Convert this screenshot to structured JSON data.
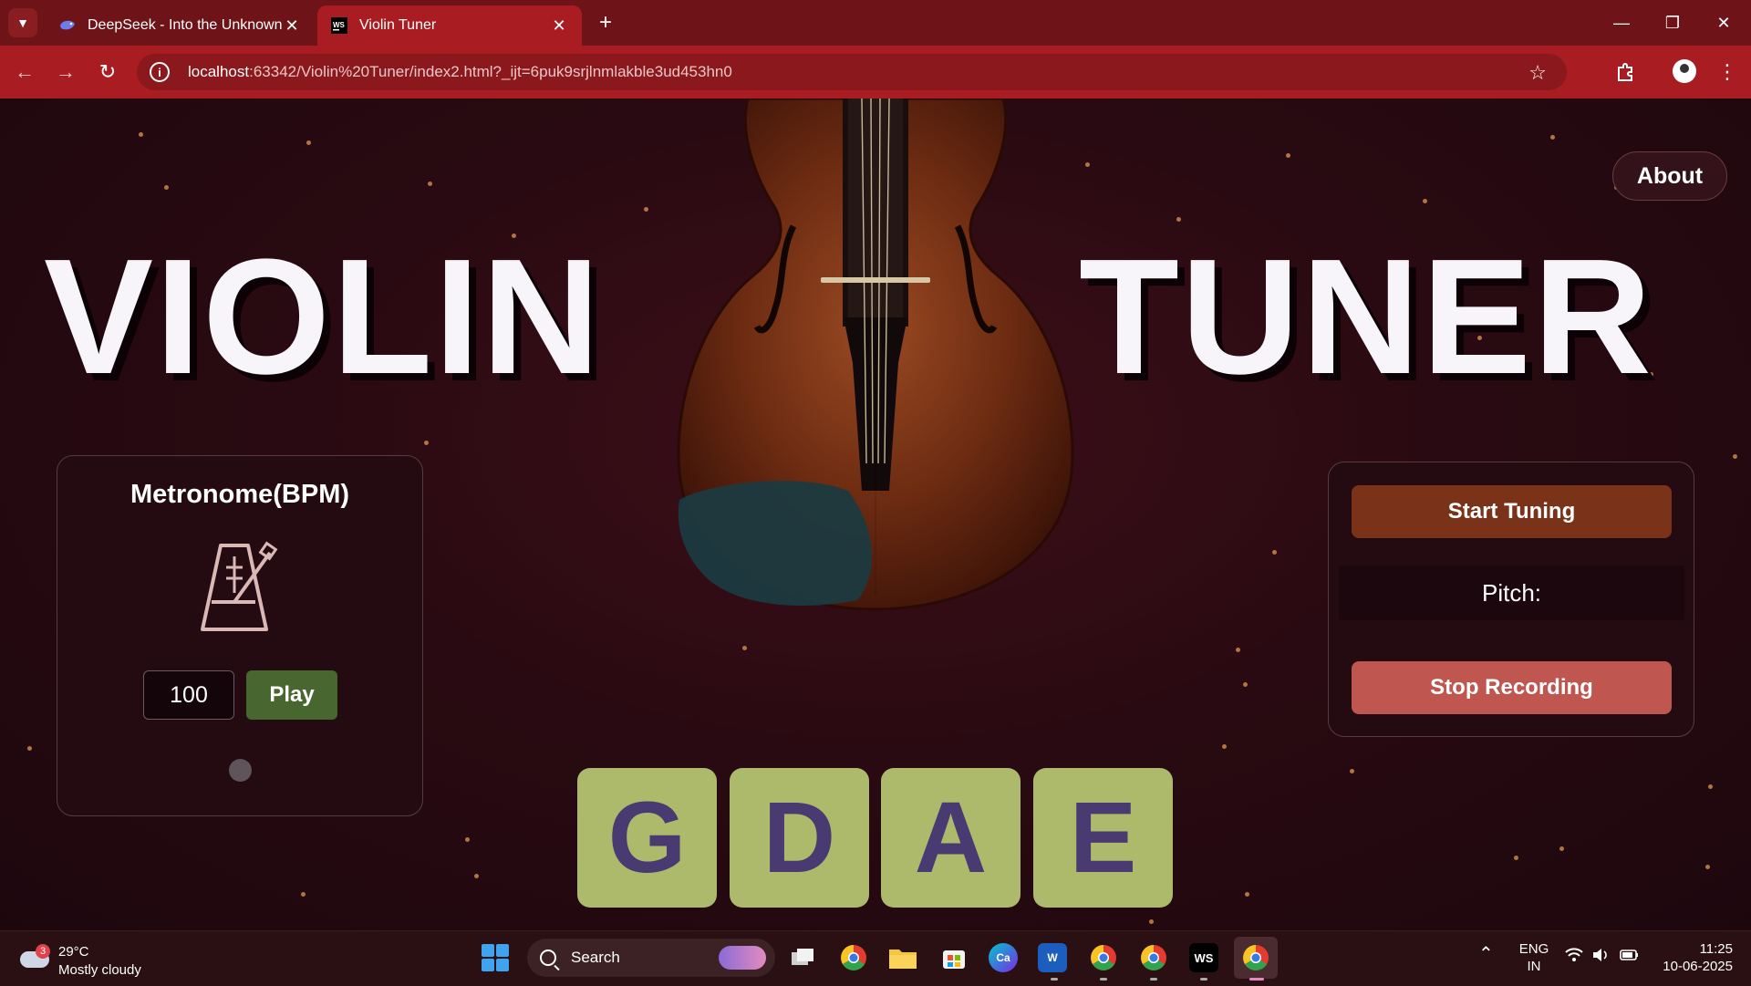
{
  "browser": {
    "tabs": [
      {
        "title": "DeepSeek - Into the Unknown",
        "icon": "deepseek-whale-icon",
        "active": false
      },
      {
        "title": "Violin Tuner",
        "icon": "webstorm-icon",
        "active": true
      }
    ],
    "url": {
      "host": "localhost",
      "path": ":63342/Violin%20Tuner/index2.html?_ijt=6puk9srjlnmlakble3ud453hn0"
    }
  },
  "page": {
    "about_label": "About",
    "hero_left": "VIOLIN",
    "hero_right": "TUNER",
    "metronome": {
      "title": "Metronome(BPM)",
      "bpm_value": "100",
      "play_label": "Play"
    },
    "tuner": {
      "start_label": "Start Tuning",
      "pitch_label": "Pitch:",
      "stop_label": "Stop Recording"
    },
    "strings": [
      "G",
      "D",
      "A",
      "E"
    ],
    "colors": {
      "string_button": "#adba6b",
      "string_letter": "#4a3a72",
      "play_button": "#48662f",
      "start_button": "#7a3219",
      "stop_button": "#c05650"
    }
  },
  "taskbar": {
    "weather": {
      "badge": "3",
      "temp": "29°C",
      "condition": "Mostly cloudy"
    },
    "search_label": "Search",
    "language": {
      "line1": "ENG",
      "line2": "IN"
    },
    "clock": {
      "time": "11:25",
      "date": "10-06-2025"
    }
  }
}
